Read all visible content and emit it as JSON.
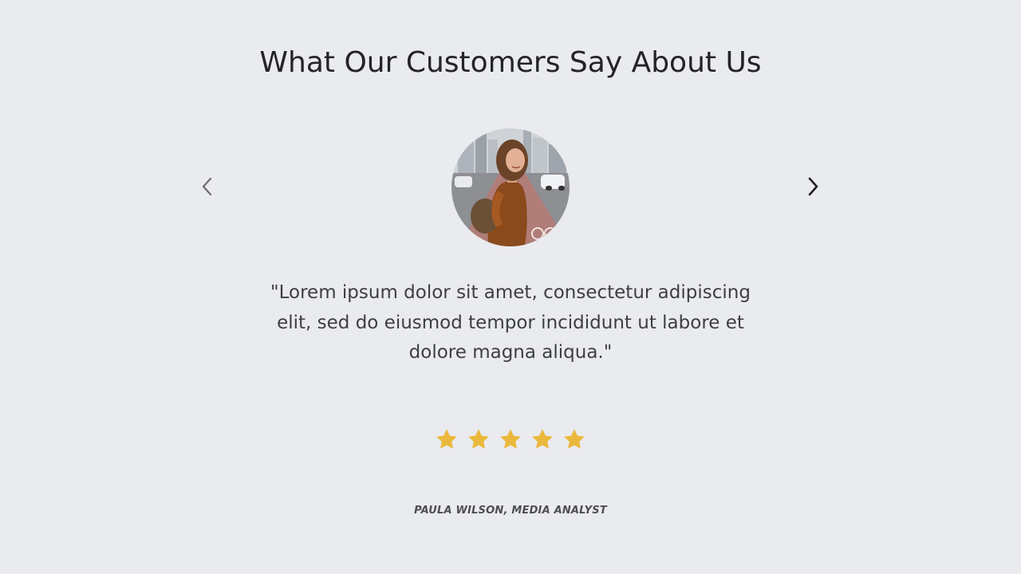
{
  "testimonials": {
    "heading": "What Our Customers Say About Us",
    "prev_icon": "chevron-left-icon",
    "next_icon": "chevron-right-icon",
    "current": {
      "avatar_icon": "customer-avatar-photo",
      "quote": "\"Lorem ipsum dolor sit amet, consectetur adipiscing elit, sed do eiusmod tempor incididunt ut labore et dolore magna aliqua.\"",
      "rating": 5,
      "rating_max": 5,
      "author": "PAULA WILSON, MEDIA ANALYST"
    }
  },
  "colors": {
    "background": "#eaebee",
    "star": "#eab83c",
    "heading": "#232427",
    "quote": "#3d3e45"
  }
}
